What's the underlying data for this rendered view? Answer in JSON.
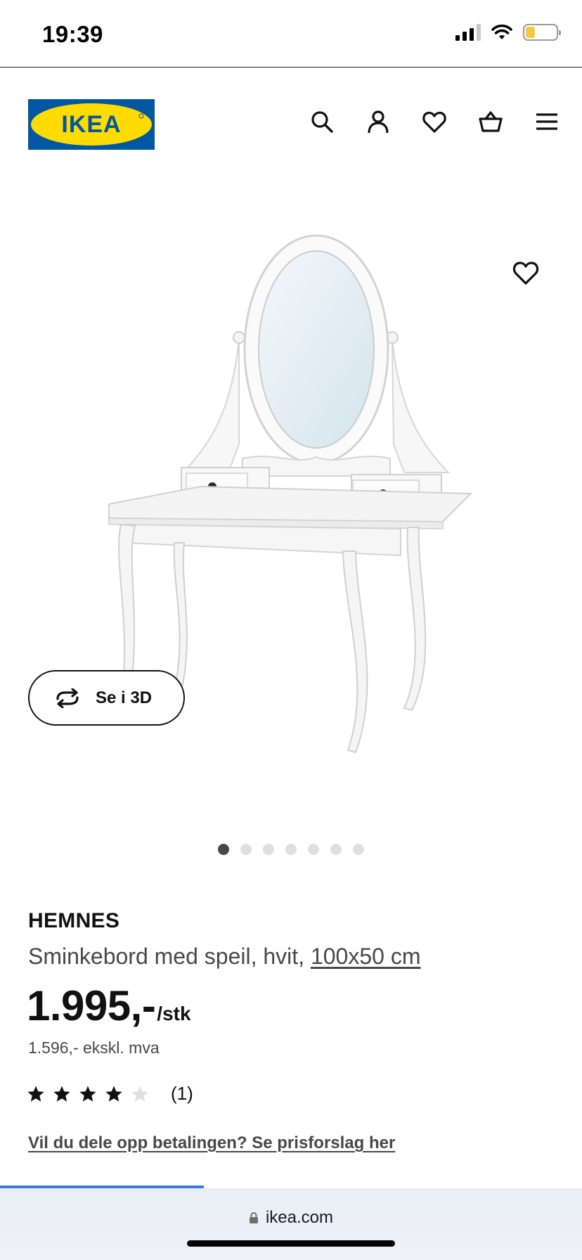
{
  "status_bar": {
    "time": "19:39",
    "signal_icon": "cellular-signal-icon",
    "wifi_icon": "wifi-icon",
    "battery_icon": "battery-icon",
    "battery_level": 0.3,
    "battery_color": "#f5c842"
  },
  "header": {
    "logo_text": "IKEA",
    "logo_colors": {
      "blue": "#0058a3",
      "yellow": "#ffdb00"
    },
    "icons": [
      "search-icon",
      "user-icon",
      "heart-icon",
      "basket-icon",
      "menu-icon"
    ]
  },
  "gallery": {
    "favorite_icon": "heart-icon",
    "view_3d_label": "Se i 3D",
    "view_3d_icon": "rotate-arrows-icon",
    "dot_count": 7,
    "active_dot": 0
  },
  "product": {
    "brand": "HEMNES",
    "description": "Sminkebord med speil, hvit,",
    "size": "100x50 cm",
    "price": "1.995,-",
    "price_unit": "/stk",
    "price_ex_vat": "1.596,- ekskl. mva",
    "rating_value": 4,
    "rating_max": 5,
    "rating_count": "(1)",
    "installment_link": "Vil du dele opp betalingen? Se prisforslag her"
  },
  "browser": {
    "url": "ikea.com",
    "lock_icon": "lock-icon",
    "load_progress": 0.35,
    "progress_color": "#3a7be0"
  }
}
